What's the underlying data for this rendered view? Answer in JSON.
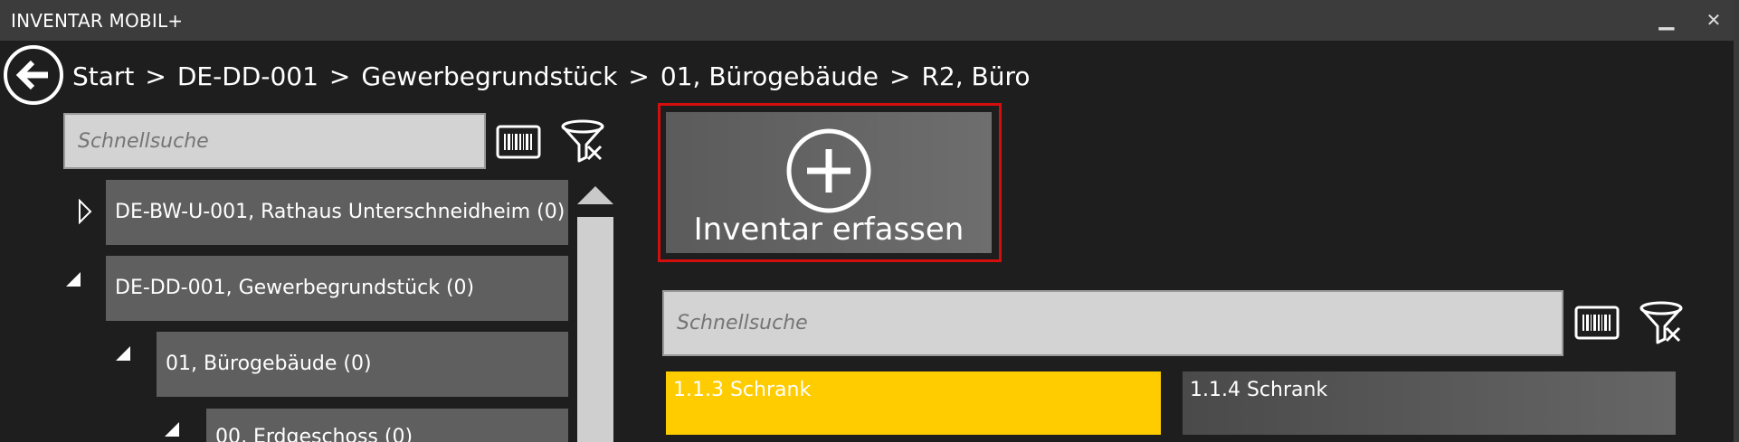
{
  "app": {
    "title": "INVENTAR MOBIL+"
  },
  "window": {
    "minimize": "▁",
    "close": "✕"
  },
  "breadcrumb": {
    "separator": ">",
    "items": [
      "Start",
      "DE-DD-001",
      "Gewerbegrundstück",
      "01, Bürogebäude",
      "R2, Büro"
    ]
  },
  "left_panel": {
    "search_placeholder": "Schnellsuche",
    "tree": [
      {
        "label": "DE-BW-U-001, Rathaus Unterschneidheim (0)",
        "expanded": false
      },
      {
        "label": "DE-DD-001, Gewerbegrundstück (0)",
        "expanded": true
      },
      {
        "label": "01, Bürogebäude (0)",
        "expanded": true
      },
      {
        "label": "00, Erdgeschoss (0)",
        "expanded": true
      }
    ]
  },
  "main": {
    "add_button_label": "Inventar erfassen",
    "search_placeholder": "Schnellsuche",
    "items": [
      {
        "label": "1.1.3 Schrank",
        "selected": true
      },
      {
        "label": "1.1.4 Schrank",
        "selected": false
      }
    ]
  },
  "icons": {
    "back": "back-arrow-icon",
    "barcode": "barcode-icon",
    "filter_clear": "filter-clear-icon",
    "add": "plus-circle-icon"
  },
  "colors": {
    "selected_item": "#ffcc00",
    "highlight_border": "#d40d0d",
    "tile": "#5f5f5f",
    "background": "#1e1e1e"
  }
}
